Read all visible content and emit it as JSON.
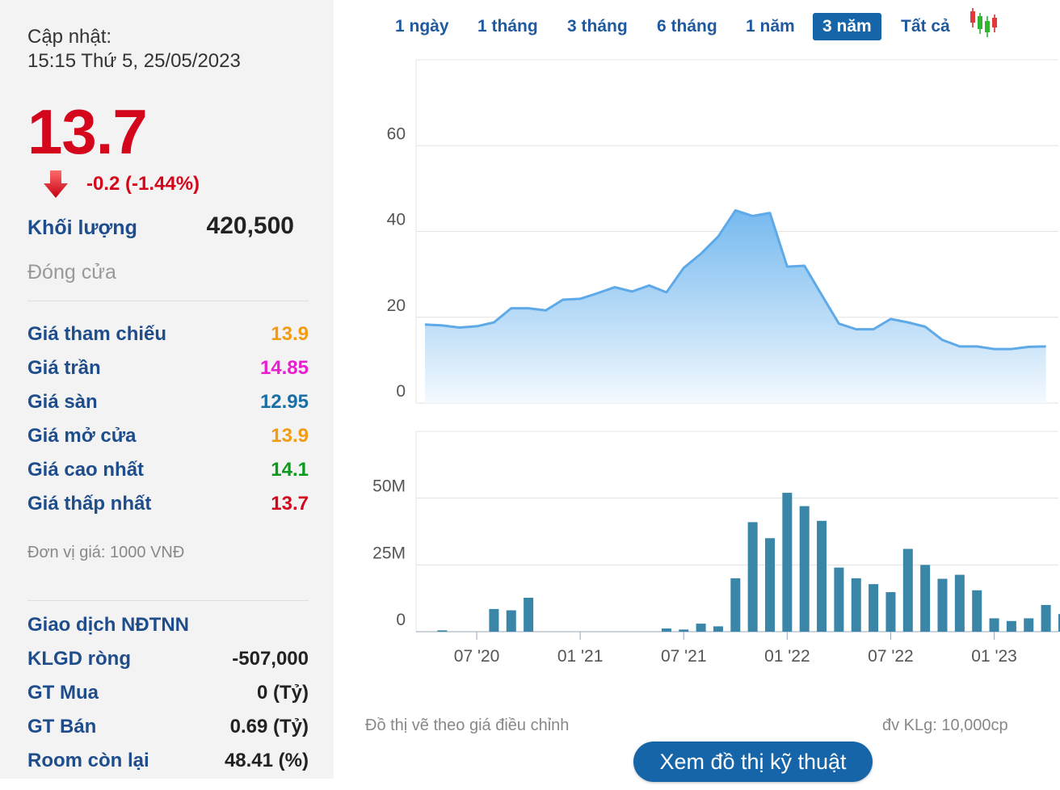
{
  "update": {
    "label": "Cập nhật:",
    "datetime": "15:15 Thứ 5, 25/05/2023"
  },
  "price": {
    "last": "13.7",
    "change": "-0.2 (-1.44%)",
    "direction_icon": "down-arrow-icon",
    "color": "#d4061c"
  },
  "volume": {
    "label": "Khối lượng",
    "value": "420,500"
  },
  "status": "Đóng cửa",
  "stats": [
    {
      "label": "Giá tham chiếu",
      "value": "13.9",
      "color": "#f39c12"
    },
    {
      "label": "Giá trần",
      "value": "14.85",
      "color": "#e91ece"
    },
    {
      "label": "Giá sàn",
      "value": "12.95",
      "color": "#1a6fa5"
    },
    {
      "label": "Giá mở cửa",
      "value": "13.9",
      "color": "#f39c12"
    },
    {
      "label": "Giá cao nhất",
      "value": "14.1",
      "color": "#0b9a1d"
    },
    {
      "label": "Giá thấp nhất",
      "value": "13.7",
      "color": "#d4061c"
    }
  ],
  "unit_note": "Đơn vị giá: 1000 VNĐ",
  "foreign": {
    "title": "Giao dịch NĐTNN",
    "rows": [
      {
        "label": "KLGD ròng",
        "value": "-507,000"
      },
      {
        "label": "GT Mua",
        "value": "0 (Tỷ)"
      },
      {
        "label": "GT Bán",
        "value": "0.69 (Tỷ)"
      },
      {
        "label": "Room còn lại",
        "value": "48.41 (%)"
      }
    ]
  },
  "tabs": [
    {
      "label": "1 ngày",
      "active": false
    },
    {
      "label": "1 tháng",
      "active": false
    },
    {
      "label": "3 tháng",
      "active": false
    },
    {
      "label": "6 tháng",
      "active": false
    },
    {
      "label": "1 năm",
      "active": false
    },
    {
      "label": "3 năm",
      "active": true
    },
    {
      "label": "Tất cả",
      "active": false
    }
  ],
  "chart_icon": "candlestick-icon",
  "chart_data": [
    {
      "type": "area",
      "x": [
        "2020-05",
        "2020-06",
        "2020-07",
        "2020-08",
        "2020-09",
        "2020-10",
        "2020-11",
        "2020-12",
        "2021-01",
        "2021-02",
        "2021-03",
        "2021-04",
        "2021-05",
        "2021-06",
        "2021-07",
        "2021-08",
        "2021-09",
        "2021-10",
        "2021-11",
        "2021-12",
        "2022-01",
        "2022-02",
        "2022-03",
        "2022-04",
        "2022-05",
        "2022-06",
        "2022-07",
        "2022-08",
        "2022-09",
        "2022-10",
        "2022-11",
        "2022-12",
        "2023-01",
        "2023-02",
        "2023-03",
        "2023-04",
        "2023-05"
      ],
      "values": [
        18.3,
        18.1,
        17.6,
        17.9,
        18.8,
        22.1,
        22.1,
        21.6,
        24.1,
        24.3,
        25.6,
        27.0,
        26.0,
        27.4,
        25.8,
        31.5,
        34.8,
        38.8,
        44.9,
        43.6,
        44.3,
        31.8,
        32.0,
        25.2,
        18.5,
        17.2,
        17.2,
        19.6,
        18.8,
        17.8,
        14.7,
        13.2,
        13.2,
        12.6,
        12.6,
        13.1,
        13.2
      ],
      "ylim": [
        0,
        80
      ],
      "yticks": [
        0,
        20,
        40,
        60
      ],
      "grid": true,
      "colors": {
        "line": "#5ea9e8",
        "fill_top": "#6fb6ee",
        "fill_bottom": "#f4f9fe"
      }
    },
    {
      "type": "bar",
      "x": [
        "2020-05",
        "2020-06",
        "2020-07",
        "2020-08",
        "2020-09",
        "2020-10",
        "2020-11",
        "2020-12",
        "2021-01",
        "2021-02",
        "2021-03",
        "2021-04",
        "2021-05",
        "2021-06",
        "2021-07",
        "2021-08",
        "2021-09",
        "2021-10",
        "2021-11",
        "2021-12",
        "2022-01",
        "2022-02",
        "2022-03",
        "2022-04",
        "2022-05",
        "2022-06",
        "2022-07",
        "2022-08",
        "2022-09",
        "2022-10",
        "2022-11",
        "2022-12",
        "2023-01",
        "2023-02",
        "2023-03",
        "2023-04",
        "2023-05"
      ],
      "values": [
        0.5,
        0,
        0,
        8.5,
        8,
        12.7,
        0,
        0,
        0,
        0,
        0,
        0,
        0,
        1.2,
        0.8,
        3,
        2,
        20,
        41,
        35,
        52,
        47,
        41.5,
        24,
        20,
        17.8,
        14.8,
        31,
        25,
        19.8,
        21.3,
        15.5,
        5,
        4,
        5,
        10,
        6.6
      ],
      "unit": "M",
      "ylim": [
        0,
        75
      ],
      "yticks": [
        0,
        25,
        50
      ],
      "ytick_labels": [
        "0",
        "25M",
        "50M"
      ],
      "grid": true,
      "colors": {
        "bar": "#3a86a8"
      }
    }
  ],
  "time_axis": {
    "labels": [
      "07 '20",
      "01 '21",
      "07 '21",
      "01 '22",
      "07 '22",
      "01 '23"
    ],
    "ticks": [
      "2020-07",
      "2021-01",
      "2021-07",
      "2022-01",
      "2022-07",
      "2023-01"
    ]
  },
  "footnotes": {
    "left": "Đồ thị vẽ theo giá điều chỉnh",
    "right": "đv KLg: 10,000cp"
  },
  "tech_button": "Xem đồ thị kỹ thuật"
}
